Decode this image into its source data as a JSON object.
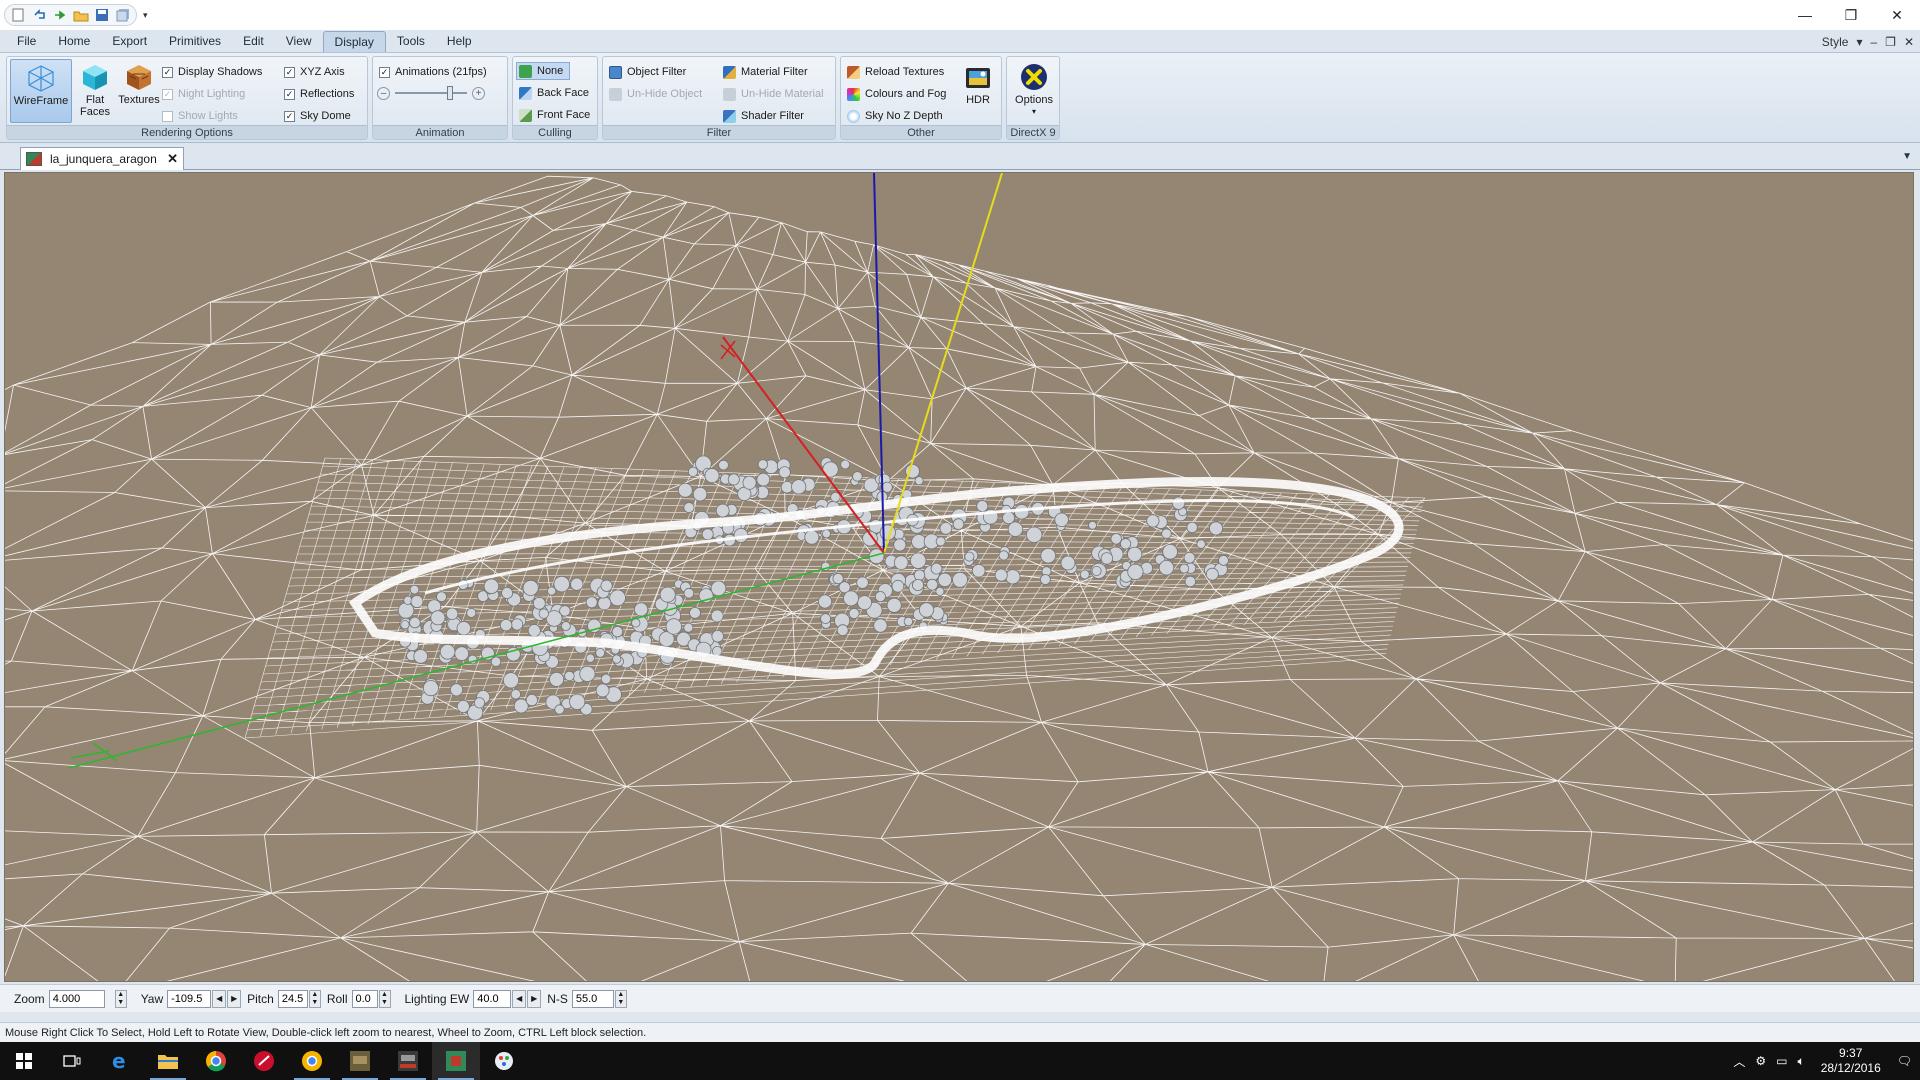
{
  "window": {
    "minimize_glyph": "—",
    "restore_glyph": "❐",
    "close_glyph": "✕"
  },
  "menu": {
    "items": [
      "File",
      "Home",
      "Export",
      "Primitives",
      "Edit",
      "View",
      "Display",
      "Tools",
      "Help"
    ],
    "active": "Display",
    "style_label": "Style",
    "style_arrow": "▾"
  },
  "ribbon": {
    "rendering_options": {
      "label": "Rendering Options",
      "wireframe": "WireFrame",
      "flat_faces_1": "Flat",
      "flat_faces_2": "Faces",
      "textures": "Textures",
      "display_shadows": "Display Shadows",
      "night_lighting": "Night Lighting",
      "show_lights": "Show Lights",
      "xyz_axis": "XYZ Axis",
      "reflections": "Reflections",
      "sky_dome": "Sky Dome"
    },
    "animation": {
      "label": "Animation",
      "animations": "Animations (21fps)"
    },
    "culling": {
      "label": "Culling",
      "none": "None",
      "back_face": "Back Face",
      "front_face": "Front Face"
    },
    "filter": {
      "label": "Filter",
      "object_filter": "Object Filter",
      "unhide_object": "Un-Hide Object",
      "material_filter": "Material Filter",
      "unhide_material": "Un-Hide Material",
      "shader_filter": "Shader Filter"
    },
    "other": {
      "label": "Other",
      "reload_textures": "Reload Textures",
      "colours_and_fog": "Colours and Fog",
      "sky_no_z_depth": "Sky No Z Depth",
      "hdr": "HDR"
    },
    "directx": {
      "label": "DirectX 9",
      "options": "Options"
    }
  },
  "document_tab": {
    "title": "la_junquera_aragon",
    "close": "✕"
  },
  "controls": {
    "zoom_label": "Zoom",
    "zoom_value": "4.000",
    "yaw_label": "Yaw",
    "yaw_value": "-109.5",
    "pitch_label": "Pitch",
    "pitch_value": "24.5",
    "roll_label": "Roll",
    "roll_value": "0.0",
    "lighting_ew_label": "Lighting EW",
    "lighting_ew_value": "40.0",
    "ns_label": "N-S",
    "ns_value": "55.0"
  },
  "status": {
    "text": "Mouse Right Click To Select, Hold Left to Rotate View, Double-click left  zoom to nearest, Wheel to Zoom, CTRL Left block selection."
  },
  "taskbar": {
    "time": "9:37",
    "date": "28/12/2016"
  },
  "colors": {
    "viewport_bg": "#958674",
    "wire": "#ffffff",
    "axis_x": "#d42020",
    "axis_y": "#1a1aa8",
    "axis_z": "#e6dc1a",
    "axis_green": "#2fb52f"
  }
}
